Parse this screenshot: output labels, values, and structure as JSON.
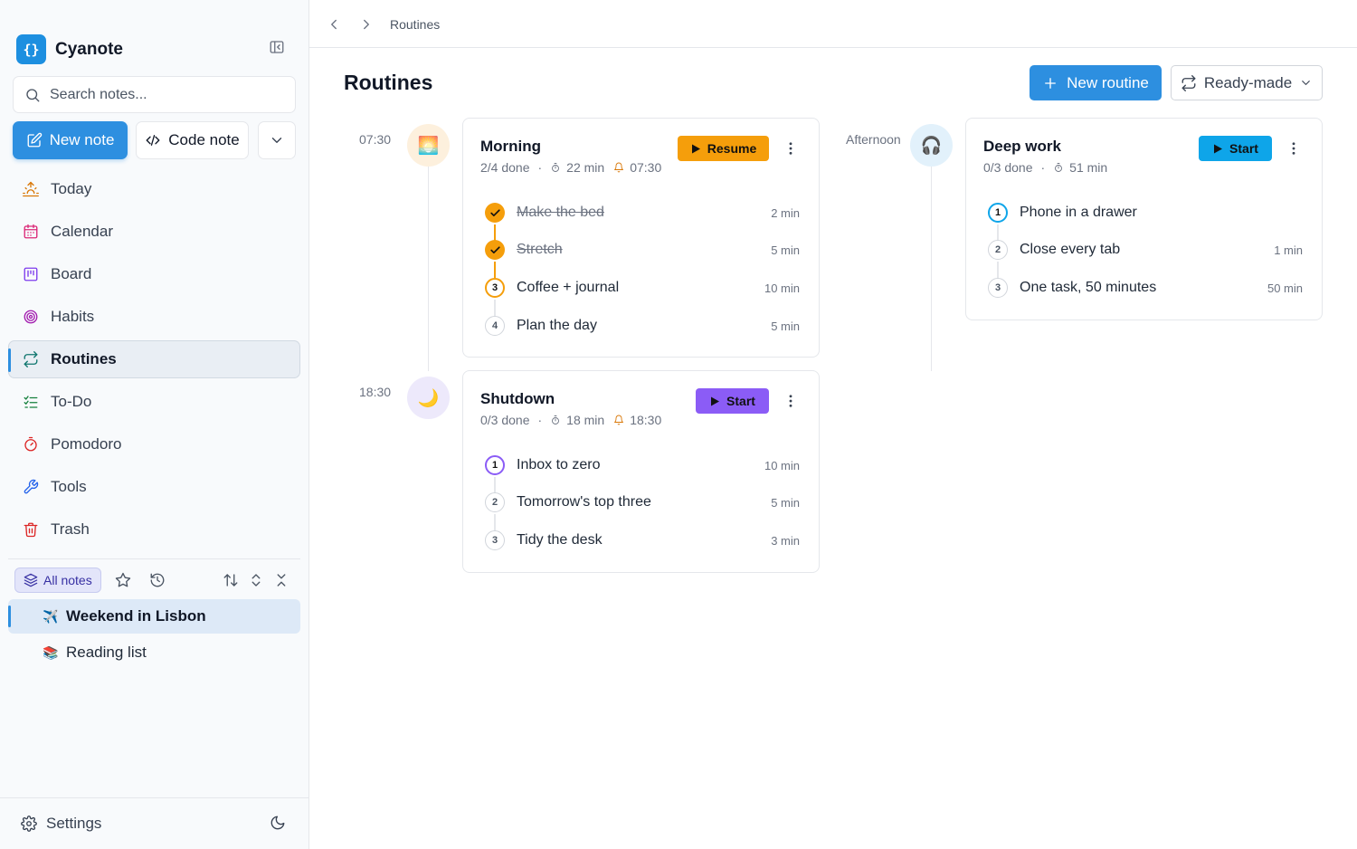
{
  "app": {
    "name": "Cyanote",
    "logo_glyph": "{}"
  },
  "sidebar": {
    "search_placeholder": "Search notes...",
    "new_note_label": "New note",
    "code_note_label": "Code note",
    "items": [
      {
        "label": "Today",
        "icon": "sunrise-icon",
        "color": "#d97706"
      },
      {
        "label": "Calendar",
        "icon": "calendar-icon",
        "color": "#db2777"
      },
      {
        "label": "Board",
        "icon": "kanban-icon",
        "color": "#7c3aed"
      },
      {
        "label": "Habits",
        "icon": "target-icon",
        "color": "#a21caf"
      },
      {
        "label": "Routines",
        "icon": "repeat-icon",
        "color": "#0f766e",
        "active": true
      },
      {
        "label": "To-Do",
        "icon": "checklist-icon",
        "color": "#15803d"
      },
      {
        "label": "Pomodoro",
        "icon": "timer-icon",
        "color": "#dc2626"
      },
      {
        "label": "Tools",
        "icon": "wrench-icon",
        "color": "#2563eb"
      },
      {
        "label": "Trash",
        "icon": "trash-icon",
        "color": "#dc2626"
      }
    ],
    "notes_filter_label": "All notes",
    "notes": [
      {
        "emoji": "✈️",
        "title": "Weekend in Lisbon",
        "active": true
      },
      {
        "emoji": "📚",
        "title": "Reading list",
        "active": false
      }
    ],
    "settings_label": "Settings"
  },
  "breadcrumb": {
    "current": "Routines"
  },
  "page": {
    "title": "Routines",
    "new_routine_label": "New routine",
    "ready_made_label": "Ready-made"
  },
  "routines": [
    {
      "time": "07:30",
      "badge_emoji": "🌅",
      "badge_bg": "#fdf0dd",
      "title": "Morning",
      "done": "2/4 done",
      "duration": "22 min",
      "alarm": "07:30",
      "action": "Resume",
      "accent": "#f59e0b",
      "steps": [
        {
          "n": "1",
          "label": "Make the bed",
          "dur": "2 min",
          "state": "done"
        },
        {
          "n": "2",
          "label": "Stretch",
          "dur": "5 min",
          "state": "done"
        },
        {
          "n": "3",
          "label": "Coffee + journal",
          "dur": "10 min",
          "state": "current"
        },
        {
          "n": "4",
          "label": "Plan the day",
          "dur": "5 min",
          "state": "todo"
        }
      ]
    },
    {
      "time": "18:30",
      "badge_emoji": "🌙",
      "badge_bg": "#ede9fb",
      "title": "Shutdown",
      "done": "0/3 done",
      "duration": "18 min",
      "alarm": "18:30",
      "action": "Start",
      "accent": "#8b5cf6",
      "steps": [
        {
          "n": "1",
          "label": "Inbox to zero",
          "dur": "10 min",
          "state": "current"
        },
        {
          "n": "2",
          "label": "Tomorrow's top three",
          "dur": "5 min",
          "state": "todo"
        },
        {
          "n": "3",
          "label": "Tidy the desk",
          "dur": "3 min",
          "state": "todo"
        }
      ]
    },
    {
      "time": "Afternoon",
      "badge_emoji": "🎧",
      "badge_bg": "#e2f1fb",
      "title": "Deep work",
      "done": "0/3 done",
      "duration": "51 min",
      "alarm": "",
      "action": "Start",
      "accent": "#0ea5e9",
      "steps": [
        {
          "n": "1",
          "label": "Phone in a drawer",
          "dur": "",
          "state": "current"
        },
        {
          "n": "2",
          "label": "Close every tab",
          "dur": "1 min",
          "state": "todo"
        },
        {
          "n": "3",
          "label": "One task, 50 minutes",
          "dur": "50 min",
          "state": "todo"
        }
      ]
    }
  ]
}
